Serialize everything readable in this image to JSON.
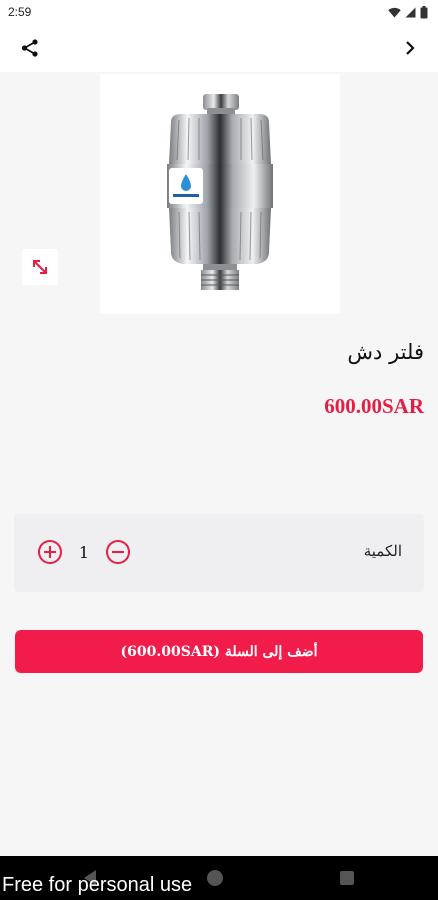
{
  "status_bar": {
    "time": "2:59",
    "icons": [
      "wifi-icon",
      "signal-icon",
      "battery-icon"
    ]
  },
  "app_bar": {
    "share_icon": "share-icon",
    "forward_icon": "chevron-right-icon"
  },
  "product": {
    "image": "shower-filter-image",
    "expand_icon": "expand-diagonal-icon",
    "title": "فلتر دش",
    "price": "600.00SAR"
  },
  "quantity": {
    "label": "الكمية",
    "value": "1",
    "increment_icon": "plus-circle-icon",
    "decrement_icon": "minus-circle-icon"
  },
  "cart_button": {
    "label": "أضف إلى السلة (600.00SAR)"
  },
  "watermark": {
    "text": "Free for personal use"
  },
  "colors": {
    "accent": "#f21c4b",
    "price": "#e61e46",
    "background": "#f7f6f7",
    "panel": "#efeef0"
  }
}
